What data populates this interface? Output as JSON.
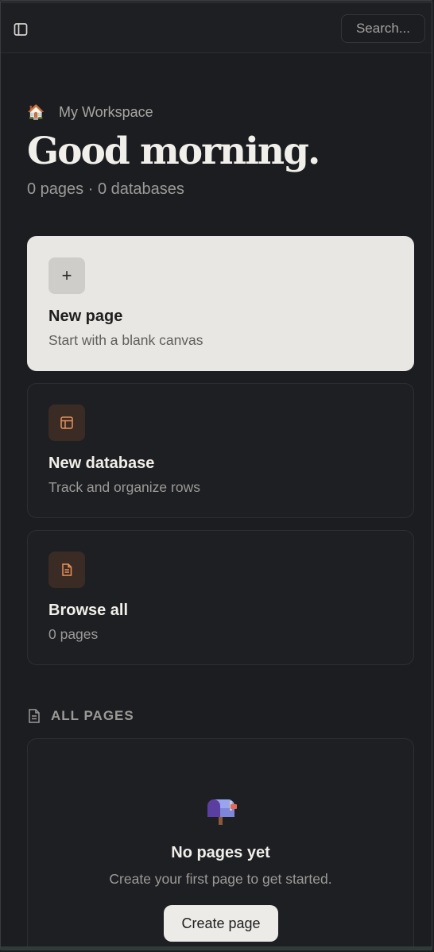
{
  "header": {
    "sidebar_toggle_icon": "sidebar-panel-icon",
    "search_label": "Search..."
  },
  "workspace": {
    "icon": "🏠",
    "name": "My Workspace"
  },
  "greeting": "Good morning.",
  "stats": "0 pages · 0 databases",
  "cards": [
    {
      "icon": "plus-icon",
      "icon_glyph": "+",
      "title": "New page",
      "subtitle": "Start with a blank canvas"
    },
    {
      "icon": "table-icon",
      "title": "New database",
      "subtitle": "Track and organize rows"
    },
    {
      "icon": "document-icon",
      "title": "Browse all",
      "subtitle": "0 pages"
    }
  ],
  "all_pages": {
    "heading": "ALL PAGES",
    "heading_icon": "document-icon",
    "empty_icon": "mailbox-icon",
    "empty_title": "No pages yet",
    "empty_subtitle": "Create your first page to get started.",
    "create_button": "Create page"
  },
  "colors": {
    "background": "#1c1d21",
    "accent": "#e8935a",
    "light_card": "#e9e7e3"
  }
}
